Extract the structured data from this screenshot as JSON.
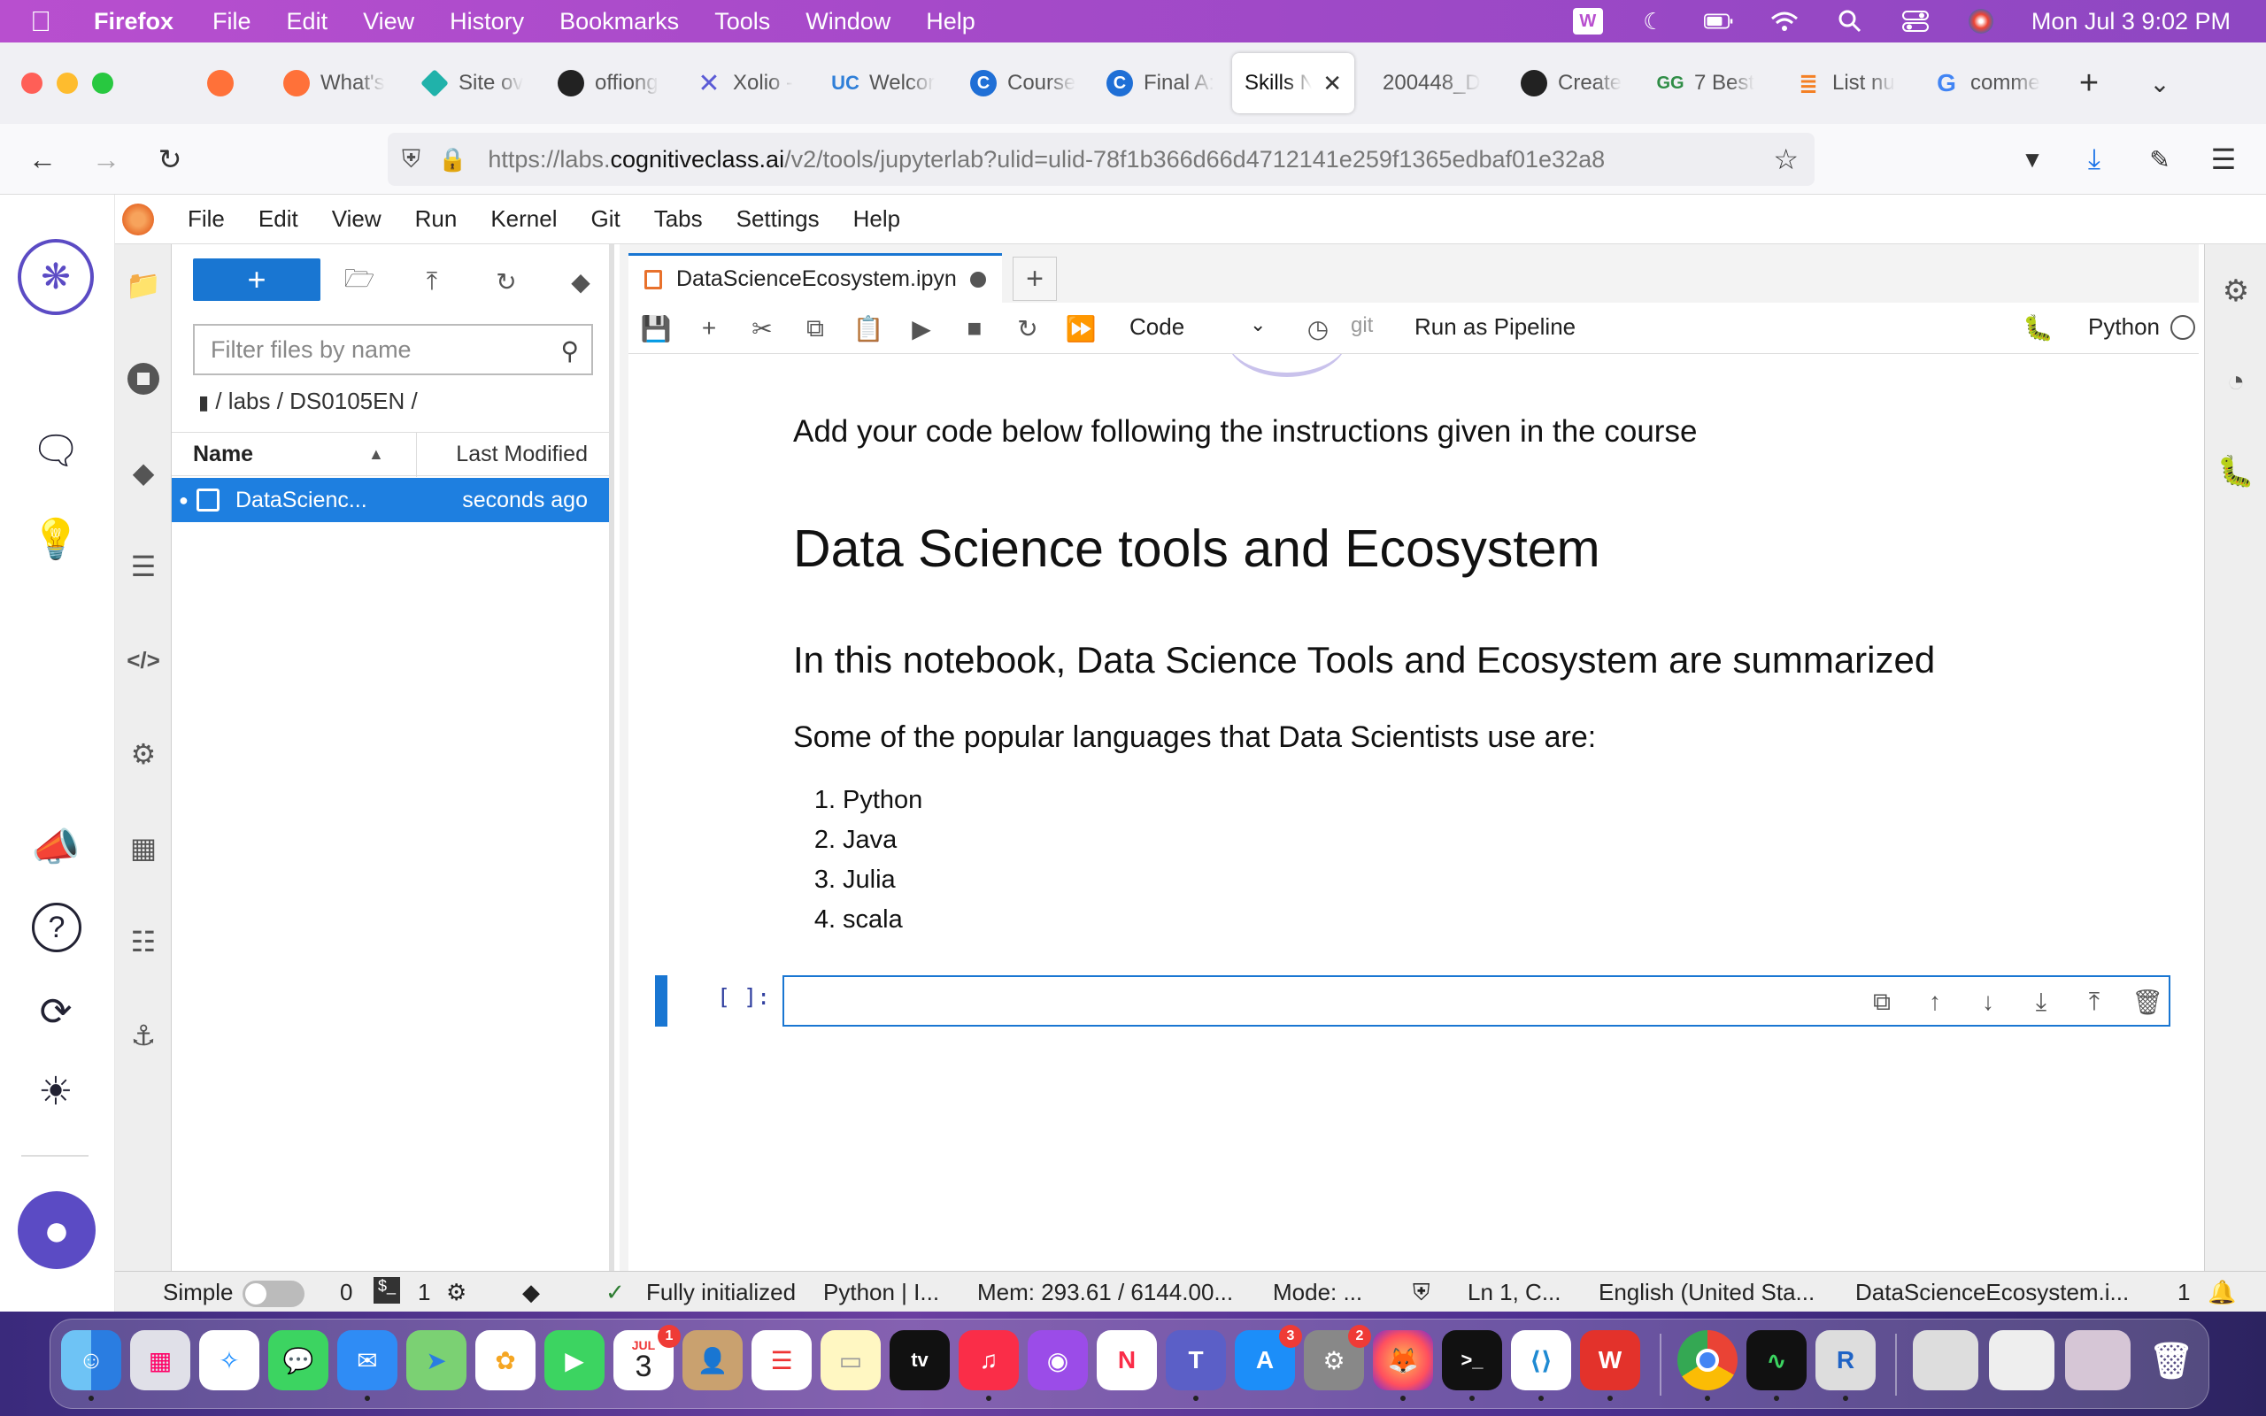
{
  "mac_menubar": {
    "app_name": "Firefox",
    "items": [
      "File",
      "Edit",
      "View",
      "History",
      "Bookmarks",
      "Tools",
      "Window",
      "Help"
    ],
    "clock": "Mon Jul 3  9:02 PM"
  },
  "browser": {
    "tabs": [
      {
        "label": "",
        "icon": "firefox-icon",
        "color": "#ff7139"
      },
      {
        "label": "What's",
        "icon": "firefox-icon",
        "color": "#ff7139"
      },
      {
        "label": "Site ov",
        "icon": "diamond-icon",
        "color": "#20b2aa"
      },
      {
        "label": "offiong",
        "icon": "github-icon",
        "color": "#222222"
      },
      {
        "label": "Xolio -",
        "icon": "xolio-icon",
        "color": "#5b5bd6"
      },
      {
        "label": "Welcor",
        "icon": "uc-icon",
        "color": "#2f7fd8"
      },
      {
        "label": "Course",
        "icon": "coursera-icon",
        "color": "#1f6fd6"
      },
      {
        "label": "Final A:",
        "icon": "coursera-icon",
        "color": "#1f6fd6"
      },
      {
        "label": "Skills Ne",
        "icon": "",
        "color": "#ffffff"
      },
      {
        "label": "200448_D",
        "icon": "",
        "color": ""
      },
      {
        "label": "Create",
        "icon": "github-icon",
        "color": "#222222"
      },
      {
        "label": "7 Best",
        "icon": "gfg-icon",
        "color": "#2f8d46"
      },
      {
        "label": "List nu",
        "icon": "stackoverflow-icon",
        "color": "#f48024"
      },
      {
        "label": "comme",
        "icon": "google-icon",
        "color": "#4285f4"
      }
    ],
    "url_prefix": "https://labs.",
    "url_domain": "cognitiveclass.ai",
    "url_rest": "/v2/tools/jupyterlab?ulid=ulid-78f1b366d66d4712141e259f1365edbaf01e32a8"
  },
  "jupyter_menu": [
    "File",
    "Edit",
    "View",
    "Run",
    "Kernel",
    "Git",
    "Tabs",
    "Settings",
    "Help"
  ],
  "file_browser": {
    "new_label": "+",
    "filter_placeholder": "Filter files by name",
    "breadcrumb": "/ labs / DS0105EN /",
    "col_name": "Name",
    "col_modified": "Last Modified",
    "files": [
      {
        "name": "DataScienc...",
        "modified": "seconds ago"
      }
    ]
  },
  "notebook": {
    "tab_title": "DataScienceEcosystem.ipyn",
    "cell_type": "Code",
    "git_label": "git",
    "pipeline_label": "Run as Pipeline",
    "kernel_name": "Python",
    "instructions": "Add your code below following the instructions given in the course",
    "heading1": "Data Science tools and Ecosystem",
    "heading2": "In this notebook, Data Science Tools and Ecosystem are summarized",
    "intro": "Some of the popular languages that Data Scientists use are:",
    "languages": [
      {
        "n": "1.",
        "name": "Python"
      },
      {
        "n": "2.",
        "name": "Java"
      },
      {
        "n": "3.",
        "name": "Julia"
      },
      {
        "n": "4.",
        "name": "scala"
      }
    ],
    "prompt": "[ ]:"
  },
  "statusbar": {
    "mode_simple": "Simple",
    "terminals": "0",
    "kernels": "1",
    "init": "Fully initialized",
    "kernel": "Python | I...",
    "mem": "Mem: 293.61 / 6144.00...",
    "mode": "Mode: ...",
    "position": "Ln 1, C...",
    "language": "English (United Sta...",
    "file": "DataScienceEcosystem.i...",
    "notifications": "1"
  },
  "dock": {
    "badges": {
      "calendar_day": "3",
      "calendar_month": "JUL",
      "calendar_badge": "1",
      "appstore_badge": "3",
      "settings_badge": "2"
    }
  }
}
